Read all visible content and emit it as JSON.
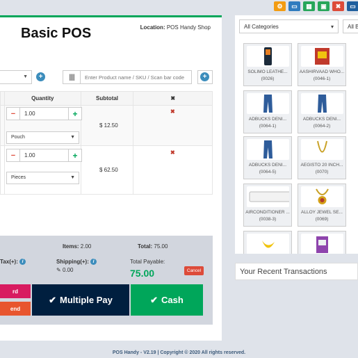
{
  "toolbar": {
    "icons": [
      "settings-icon",
      "window-icon",
      "calculator-icon",
      "briefcase-icon",
      "close-icon",
      "screen-icon"
    ]
  },
  "header": {
    "title": "Basic POS",
    "location_label": "Location:",
    "location_value": "POS Handy Shop"
  },
  "search": {
    "product_placeholder": "Enter Product name / SKU / Scan bar code"
  },
  "cart": {
    "headers": {
      "quantity": "Quantity",
      "subtotal": "Subtotal",
      "remove": "✖"
    },
    "rows": [
      {
        "qty": "1.00",
        "unit": "Pouch",
        "subtotal": "$ 12.50"
      },
      {
        "qty": "1.00",
        "unit": "Pieces",
        "subtotal": "$ 62.50"
      }
    ]
  },
  "summary": {
    "items_label": "Items:",
    "items_value": "2.00",
    "total_label": "Total:",
    "total_value": "75.00",
    "tax_label": "Tax(+):",
    "shipping_label": "Shipping(+):",
    "shipping_value": "0.00",
    "payable_label": "Total Payable:",
    "payable_value": "75.00",
    "cancel_label": "Cancel"
  },
  "actions": {
    "card_label": "rd",
    "suspend_label": "end",
    "multiple_pay_label": "Multiple Pay",
    "cash_label": "Cash"
  },
  "catalog": {
    "category_selected": "All Categories",
    "brand_selected": "All B",
    "products": [
      {
        "name": "SOLIMO LEATHE...",
        "code": "(0026)"
      },
      {
        "name": "AASHIRVAAD WHO...",
        "code": "(0046-1)"
      },
      {
        "name": "ADBUCKS DENI...",
        "code": "(0064-1)"
      },
      {
        "name": "ADBUCKS DENI...",
        "code": "(0064-2)"
      },
      {
        "name": "ADBUCKS DENI...",
        "code": "(0064-5)"
      },
      {
        "name": "AEGISTO 20 INCH...",
        "code": "(0070)"
      },
      {
        "name": "AIRCONDITIONER ...",
        "code": "(0038-3)"
      },
      {
        "name": "ALLOY JEWEL SE...",
        "code": "(0069)"
      },
      {
        "name": "",
        "code": ""
      },
      {
        "name": "",
        "code": ""
      }
    ]
  },
  "recent": {
    "title": "Your Recent Transactions"
  },
  "footer": {
    "text": "POS Handy - V2.19 | Copyright © 2020 All rights reserved."
  },
  "colors": {
    "accent_green": "#00a65a",
    "primary_blue": "#3c8dbc",
    "danger_red": "#dd4b39",
    "navy": "#001f3f"
  }
}
